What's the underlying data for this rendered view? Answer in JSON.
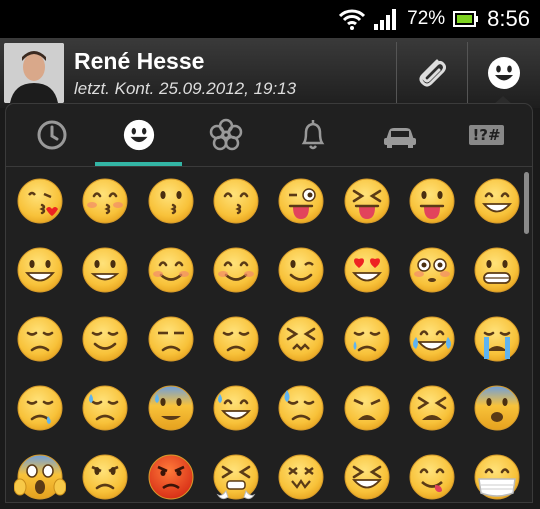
{
  "status_bar": {
    "battery_percent": "72%",
    "time": "8:56"
  },
  "contact": {
    "name": "René Hesse",
    "last_seen": "letzt. Kont. 25.09.2012, 19:13"
  },
  "emoji_tabs": {
    "symbols_label": "!?#",
    "selected_index": 1
  },
  "emoji_grid": [
    "kiss-heart",
    "kiss-blush",
    "kiss",
    "kiss-smiling-eyes",
    "wink-tongue",
    "squint-tongue",
    "tongue",
    "grin-wide",
    "smiley",
    "grin",
    "blush",
    "relaxed",
    "wink",
    "heart-eyes",
    "flushed",
    "grimace",
    "pensive",
    "relieved",
    "unamused",
    "disappointed",
    "confounded",
    "crying",
    "joy",
    "sob",
    "sleepy",
    "disappointed-relieved",
    "cold-sweat",
    "sweat-smile",
    "sweat",
    "weary",
    "tired",
    "fearful",
    "scream",
    "angry",
    "rage",
    "triumph",
    "astonished",
    "laughing",
    "yum",
    "mask"
  ]
}
